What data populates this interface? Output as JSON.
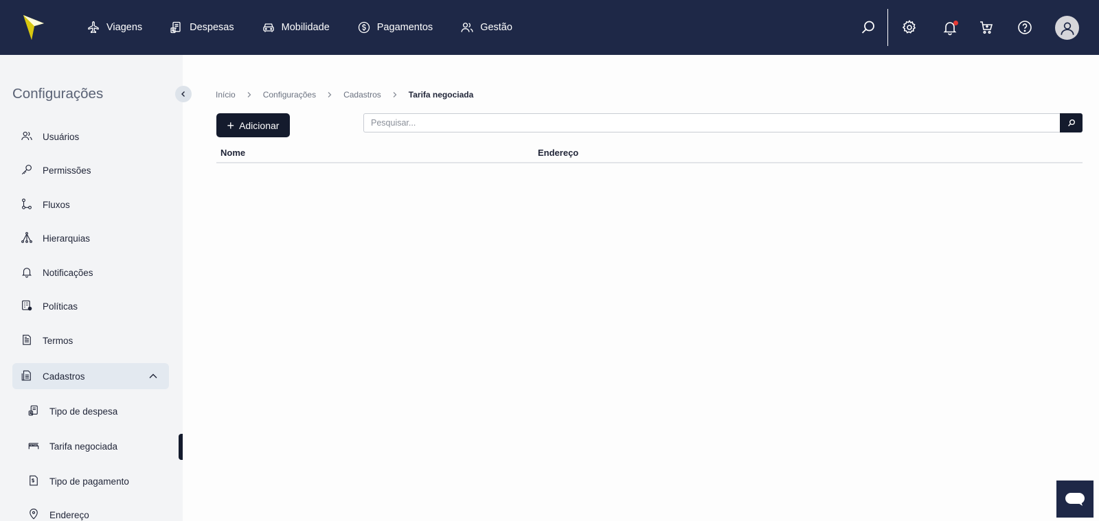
{
  "app": {
    "logo_icon": "brand-arrow-logo",
    "colors": {
      "topbar": "#1e2847",
      "accent": "#f2e21a",
      "primary_button": "#141b2d",
      "notification_dot": "#e53935"
    }
  },
  "topnav": {
    "items": [
      {
        "label": "Viagens",
        "icon": "airplane-icon"
      },
      {
        "label": "Despesas",
        "icon": "receipt-icon"
      },
      {
        "label": "Mobilidade",
        "icon": "car-icon"
      },
      {
        "label": "Pagamentos",
        "icon": "dollar-circle-icon"
      },
      {
        "label": "Gestão",
        "icon": "users-icon"
      }
    ],
    "right_icons": [
      "search-icon",
      "gear-icon",
      "bell-icon",
      "cart-icon",
      "help-icon",
      "user-avatar-icon"
    ]
  },
  "sidebar": {
    "title": "Configurações",
    "items": [
      {
        "label": "Usuários",
        "icon": "users-icon"
      },
      {
        "label": "Permissões",
        "icon": "key-icon"
      },
      {
        "label": "Fluxos",
        "icon": "flow-icon"
      },
      {
        "label": "Hierarquias",
        "icon": "hierarchy-icon"
      },
      {
        "label": "Notificações",
        "icon": "bell-icon"
      },
      {
        "label": "Políticas",
        "icon": "policy-icon"
      },
      {
        "label": "Termos",
        "icon": "document-icon"
      },
      {
        "label": "Cadastros",
        "icon": "file-list-icon",
        "expanded": true
      }
    ],
    "sub_items": [
      {
        "label": "Tipo de despesa",
        "icon": "receipt-icon"
      },
      {
        "label": "Tarifa negociada",
        "icon": "bed-icon",
        "active": true
      },
      {
        "label": "Tipo de pagamento",
        "icon": "payment-doc-icon"
      },
      {
        "label": "Endereço",
        "icon": "location-pin-icon"
      }
    ]
  },
  "breadcrumb": {
    "items": [
      "Início",
      "Configurações",
      "Cadastros"
    ],
    "current": "Tarifa negociada"
  },
  "toolbar": {
    "add_label": "Adicionar",
    "search_placeholder": "Pesquisar..."
  },
  "table": {
    "columns": [
      "Nome",
      "Endereço"
    ],
    "rows": []
  }
}
